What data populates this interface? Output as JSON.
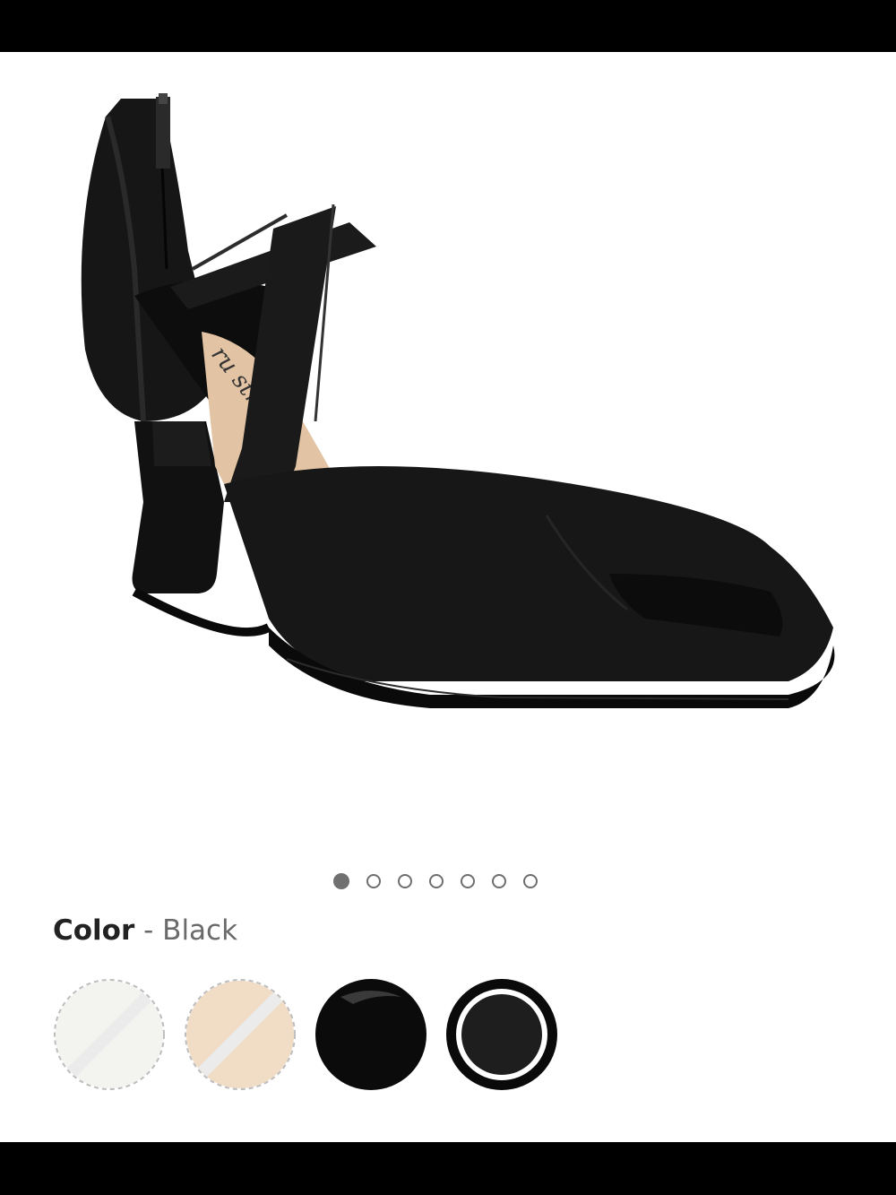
{
  "product": {
    "image_alt": "black peep-toe T-strap heeled sandal",
    "sole_print": "ru street"
  },
  "carousel": {
    "count": 7,
    "active_index": 0
  },
  "color_selector": {
    "label": "Color",
    "separator": "-",
    "selected_value": "Black",
    "swatches": [
      {
        "name": "White",
        "color": "#f3f3f0",
        "available": false,
        "selected": false
      },
      {
        "name": "Nude",
        "color": "#f1dcc6",
        "available": false,
        "selected": false
      },
      {
        "name": "Black Leather",
        "color": "#0b0b0b",
        "available": true,
        "selected": false
      },
      {
        "name": "Black",
        "color": "#1e1e1e",
        "available": true,
        "selected": true
      }
    ]
  },
  "colors": {
    "status_bar": "#000000",
    "dot_active": "#707070",
    "dot_border": "#6e6e6e",
    "label_text": "#222222",
    "value_text": "#6a6a6a"
  }
}
